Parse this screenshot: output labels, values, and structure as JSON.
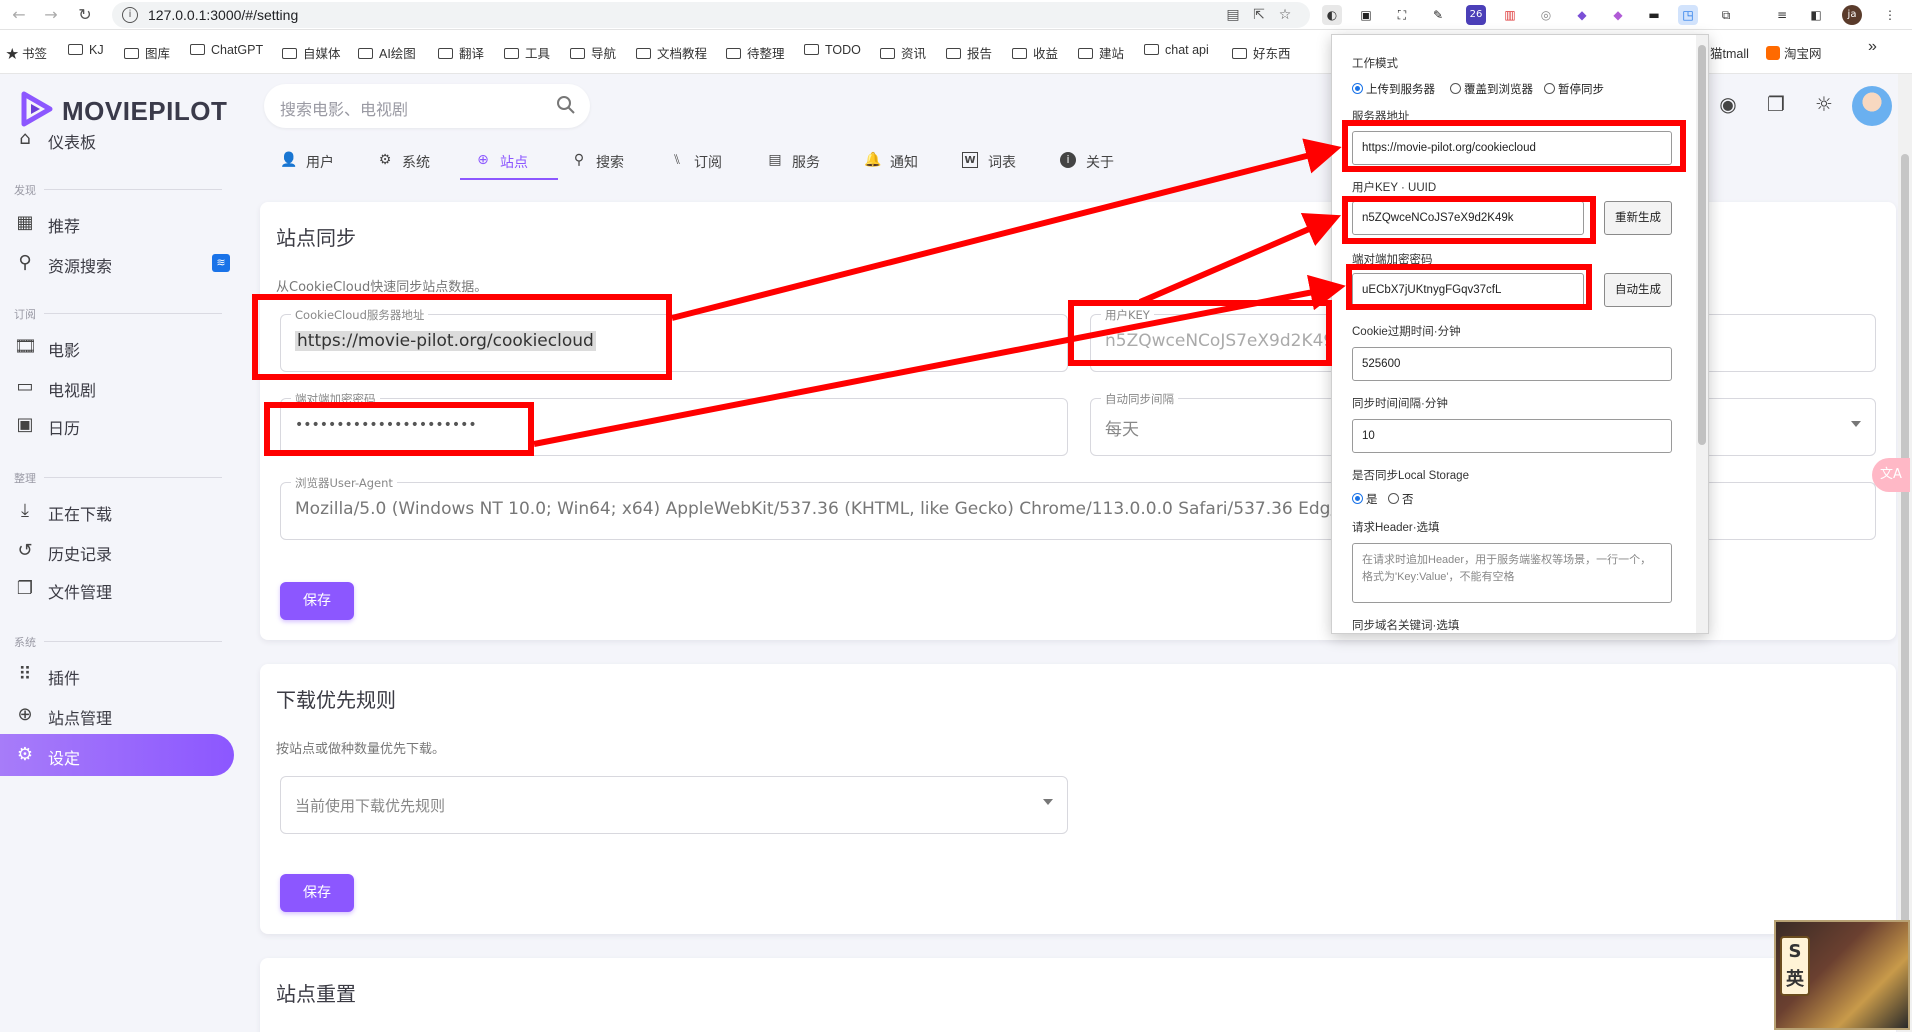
{
  "browser": {
    "url": "127.0.0.1:3000/#/setting",
    "bookmarks": [
      {
        "label": "书签",
        "icon": "star-icon"
      },
      {
        "label": "KJ"
      },
      {
        "label": "图库"
      },
      {
        "label": "ChatGPT"
      },
      {
        "label": "自媒体"
      },
      {
        "label": "AI绘图"
      },
      {
        "label": "翻译"
      },
      {
        "label": "工具"
      },
      {
        "label": "导航"
      },
      {
        "label": "文档教程"
      },
      {
        "label": "待整理"
      },
      {
        "label": "TODO"
      },
      {
        "label": "资讯"
      },
      {
        "label": "报告"
      },
      {
        "label": "收益"
      },
      {
        "label": "建站"
      },
      {
        "label": "chat api"
      },
      {
        "label": "好东西"
      }
    ],
    "bookmarks_right": [
      {
        "label": "猫tmall"
      },
      {
        "label": "淘宝网"
      }
    ],
    "extension_badge": "26"
  },
  "app": {
    "logo_text": "MOVIEPILOT",
    "brand_color": "#8c57ff",
    "search_placeholder": "搜索电影、电视剧"
  },
  "sidebar": {
    "dashboard": "仪表板",
    "section_discover": "发现",
    "recommend": "推荐",
    "resource_search": "资源搜索",
    "section_subscribe": "订阅",
    "movies": "电影",
    "tv": "电视剧",
    "calendar": "日历",
    "section_organize": "整理",
    "downloading": "正在下载",
    "history": "历史记录",
    "file_manager": "文件管理",
    "section_system": "系统",
    "plugins": "插件",
    "site_management": "站点管理",
    "settings": "设定"
  },
  "tabs": [
    {
      "label": "用户",
      "icon": "user-icon"
    },
    {
      "label": "系统",
      "icon": "gear-icon"
    },
    {
      "label": "站点",
      "icon": "globe-icon",
      "active": true
    },
    {
      "label": "搜索",
      "icon": "search-icon"
    },
    {
      "label": "订阅",
      "icon": "rss-icon"
    },
    {
      "label": "服务",
      "icon": "list-icon"
    },
    {
      "label": "通知",
      "icon": "bell-icon"
    },
    {
      "label": "词表",
      "icon": "word-icon"
    },
    {
      "label": "关于",
      "icon": "info-icon"
    }
  ],
  "site_sync": {
    "title": "站点同步",
    "subtitle": "从CookieCloud快速同步站点数据。",
    "server_label": "CookieCloud服务器地址",
    "server_value": "https://movie-pilot.org/cookiecloud",
    "user_key_label": "用户KEY",
    "user_key_value": "n5ZQwceNCoJS7eX9d2K49k",
    "password_label": "端对端加密密码",
    "password_value": "••••••••••••••••••••••",
    "interval_label": "自动同步间隔",
    "interval_value": "每天",
    "ua_label": "浏览器User-Agent",
    "ua_value": "Mozilla/5.0 (Windows NT 10.0; Win64; x64) AppleWebKit/537.36 (KHTML, like Gecko) Chrome/113.0.0.0 Safari/537.36 Edg/113.0.1774",
    "save": "保存"
  },
  "download_rules": {
    "title": "下载优先规则",
    "subtitle": "按站点或做种数量优先下载。",
    "select_placeholder": "当前使用下载优先规则",
    "save": "保存"
  },
  "site_reset": {
    "title": "站点重置"
  },
  "popup": {
    "mode_label": "工作模式",
    "mode_options": [
      "上传到服务器",
      "覆盖到浏览器",
      "暂停同步"
    ],
    "server_label": "服务器地址",
    "server_value": "https://movie-pilot.org/cookiecloud",
    "uuid_label": "用户KEY · UUID",
    "uuid_value": "n5ZQwceNCoJS7eX9d2K49k",
    "regen_button": "重新生成",
    "password_label": "端对端加密密码",
    "password_value": "uECbX7jUKtnygFGqv37cfL",
    "auto_gen_button": "自动生成",
    "expire_label": "Cookie过期时间·分钟",
    "expire_value": "525600",
    "interval_label": "同步时间间隔·分钟",
    "interval_value": "10",
    "local_storage_label": "是否同步Local Storage",
    "yes": "是",
    "no": "否",
    "header_label": "请求Header·选填",
    "header_placeholder": "在请求时追加Header，用于服务端鉴权等场景，一行一个，格式为'Key:Value'，不能有空格",
    "domain_label": "同步域名关键词·选填"
  },
  "colors": {
    "accent": "#8c57ff",
    "annotation": "#ff0000"
  }
}
